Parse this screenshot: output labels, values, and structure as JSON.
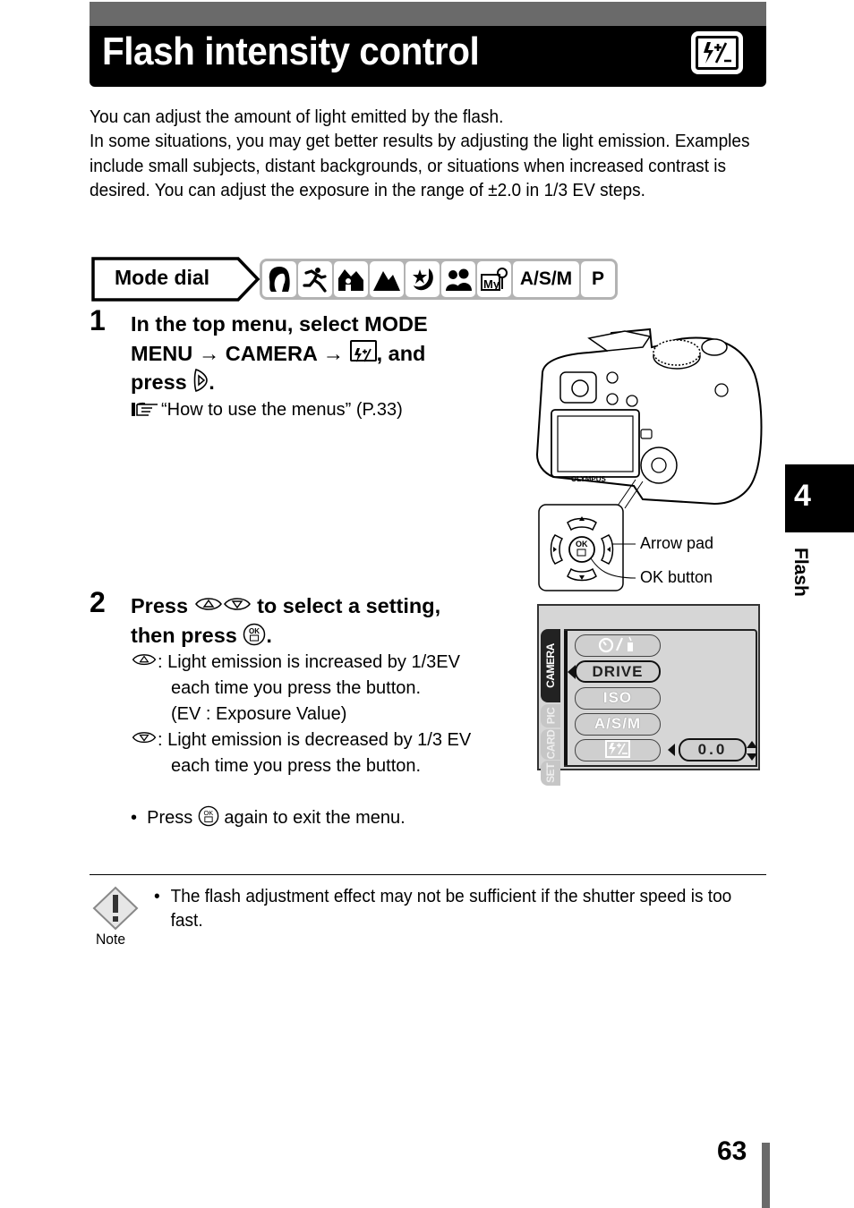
{
  "header": {
    "title": "Flash intensity control",
    "icon": "flash-intensity-icon"
  },
  "intro": {
    "lines": [
      "You can adjust the amount of light emitted by the flash.",
      "In some situations, you may get better results by adjusting the light emission. Examples include small subjects, distant backgrounds, or situations when increased contrast is desired. You can adjust the exposure in the range of ±2.0 in 1/3 EV steps."
    ]
  },
  "mode_dial": {
    "label": "Mode dial",
    "icons": [
      {
        "name": "portrait-icon"
      },
      {
        "name": "sport-icon"
      },
      {
        "name": "landscape-portrait-icon"
      },
      {
        "name": "landscape-icon"
      },
      {
        "name": "night-scene-icon"
      },
      {
        "name": "self-portrait-icon"
      },
      {
        "name": "my-mode-icon"
      },
      {
        "name": "asm-mode",
        "label": "A/S/M"
      },
      {
        "name": "program-mode",
        "label": "P"
      }
    ]
  },
  "step1": {
    "number": "1",
    "line1": "In the top menu, select MODE",
    "line2_a": "MENU → CAMERA →",
    "line2_b": ", and",
    "line3_a": "press",
    "line3_b": ".",
    "ref_text": "“How to use the menus” (P.33)"
  },
  "camera_figure": {
    "brand": "OLYMPUS",
    "callouts": {
      "arrow_pad": "Arrow pad",
      "ok_button": "OK button"
    }
  },
  "step2": {
    "number": "2",
    "line1_a": "Press",
    "line1_b": "to select a setting,",
    "line2_a": "then press",
    "line2_b": ".",
    "up_desc_1": ": Light emission is increased by 1/3EV",
    "up_desc_2": "each time you press the button.",
    "up_desc_3": "(EV : Exposure Value)",
    "down_desc_1": ": Light emission is decreased by 1/3 EV",
    "down_desc_2": "each time you press the button.",
    "bullet_a": "Press",
    "bullet_b": "again to exit the menu."
  },
  "menu_screen": {
    "tabs": [
      "CAMERA",
      "PIC",
      "CARD",
      "SET"
    ],
    "active_tab": "CAMERA",
    "items": [
      {
        "label": "ὕ/὏",
        "name": "self-timer-remote-item"
      },
      {
        "label": "DRIVE",
        "name": "drive-item"
      },
      {
        "label": "ISO",
        "name": "iso-item"
      },
      {
        "label": "A/S/M",
        "name": "asm-item"
      },
      {
        "label": "",
        "name": "flash-intensity-item"
      }
    ],
    "selected_item": "DRIVE",
    "value": "0.0"
  },
  "note": {
    "label": "Note",
    "text": "The flash adjustment effect may not be sufficient if the shutter speed is too fast."
  },
  "chapter": {
    "number": "4",
    "label": "Flash"
  },
  "page_number": "63"
}
